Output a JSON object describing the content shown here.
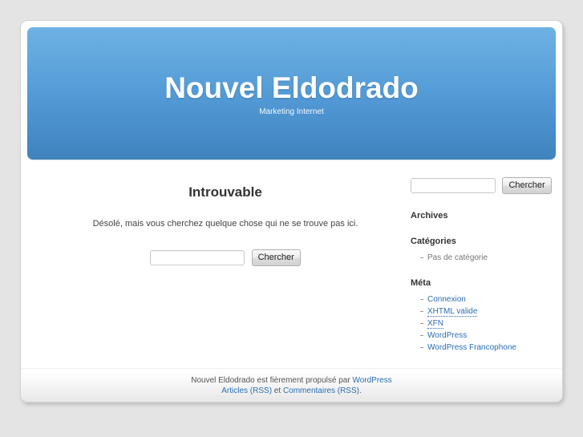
{
  "site": {
    "title": "Nouvel Eldodrado",
    "description": "Marketing Internet",
    "accent_color": "#4e95d2",
    "link_color": "#2a6eb5",
    "page_background": "#e4e4e4"
  },
  "main": {
    "entry_title": "Introuvable",
    "entry_text": "Désolé, mais vous cherchez quelque chose qui ne se trouve pas ici.",
    "search": {
      "value": "",
      "placeholder": "",
      "submit_label": "Chercher"
    }
  },
  "sidebar": {
    "search": {
      "value": "",
      "placeholder": "",
      "submit_label": "Chercher"
    },
    "widgets": [
      {
        "title": "Archives",
        "items": []
      },
      {
        "title": "Catégories",
        "items": [
          {
            "label": "Pas de catégorie",
            "is_link": false
          }
        ]
      },
      {
        "title": "Méta",
        "items": [
          {
            "label": "Connexion",
            "is_link": true,
            "dotted": false
          },
          {
            "label": "XHTML valide",
            "is_link": true,
            "dotted": true
          },
          {
            "label": "XFN",
            "is_link": true,
            "dotted": true
          },
          {
            "label": "WordPress",
            "is_link": true,
            "dotted": false
          },
          {
            "label": "WordPress Francophone",
            "is_link": true,
            "dotted": false
          }
        ]
      }
    ]
  },
  "footer": {
    "line1_prefix": "Nouvel Eldodrado est fièrement propulsé par ",
    "line1_link": "WordPress",
    "line2_link1": "Articles (RSS)",
    "line2_mid": " et ",
    "line2_link2": "Commentaires (RSS)",
    "line2_suffix": "."
  }
}
